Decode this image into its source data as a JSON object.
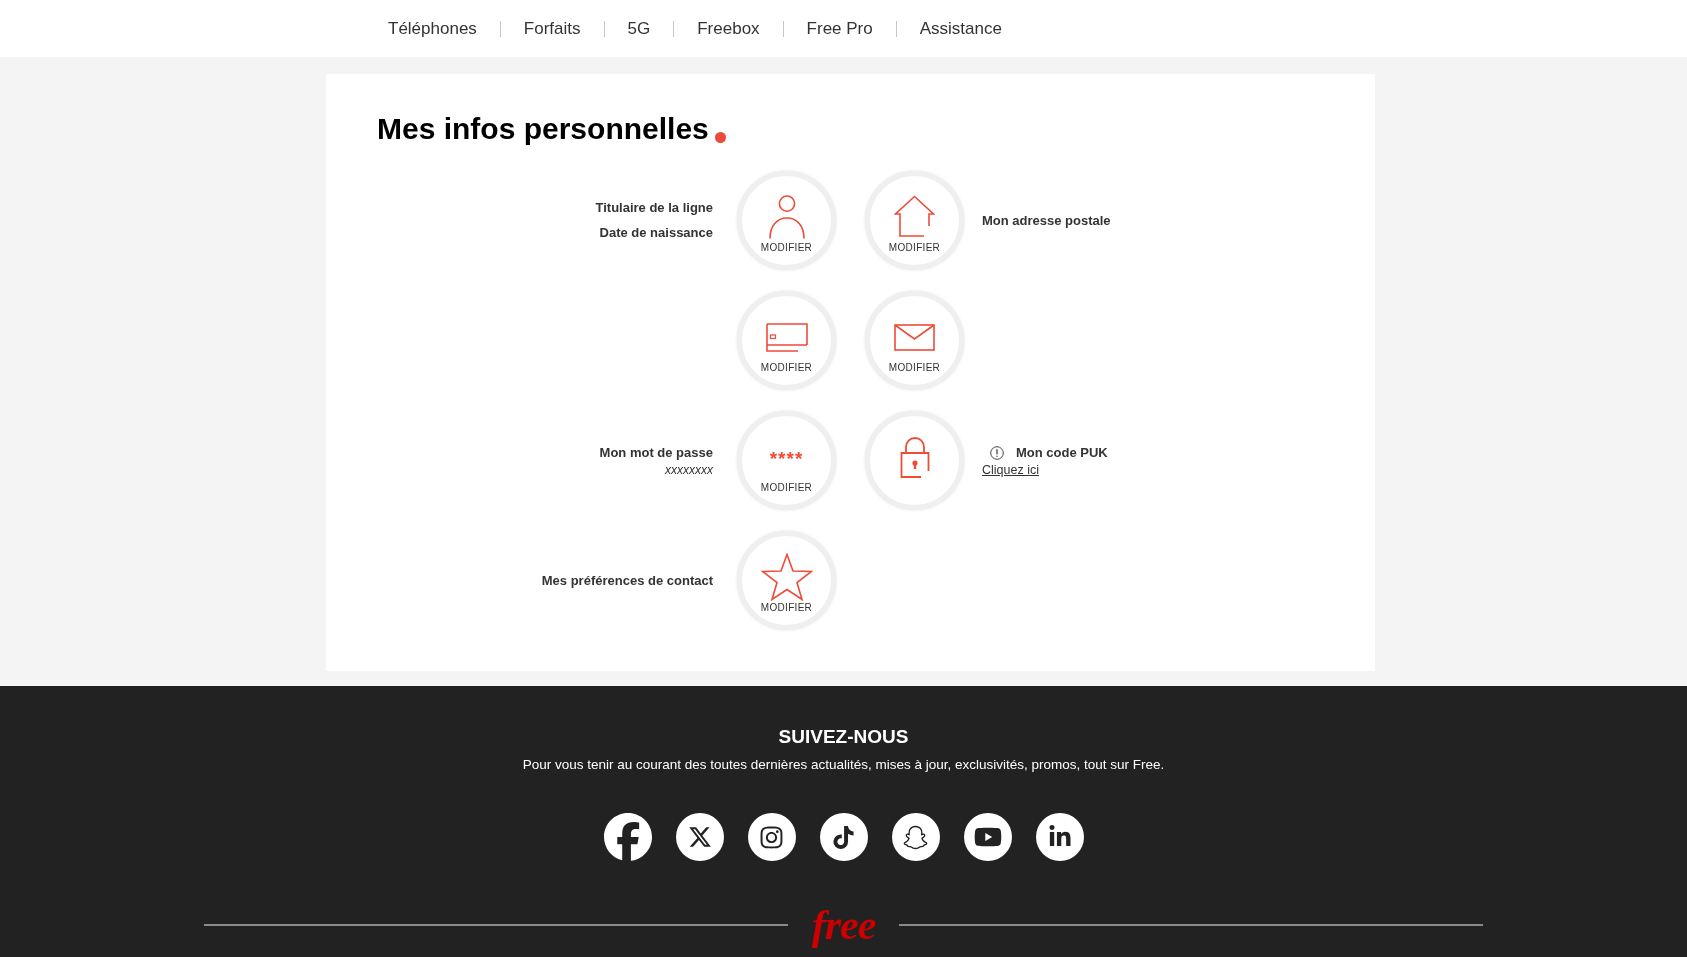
{
  "nav": [
    {
      "label": "Téléphones"
    },
    {
      "label": "Forfaits"
    },
    {
      "label": "5G"
    },
    {
      "label": "Freebox"
    },
    {
      "label": "Free Pro"
    },
    {
      "label": "Assistance"
    }
  ],
  "page": {
    "title": "Mes infos personnelles",
    "rows": [
      {
        "labels": [
          "Titulaire de la ligne",
          "Date de naissance"
        ],
        "tiles": [
          {
            "kind": "holder",
            "action": "MODIFIER"
          },
          {
            "kind": "address",
            "action": "MODIFIER"
          }
        ],
        "aside": {
          "kind": "plain",
          "title": "Mon adresse postale"
        }
      },
      {
        "tiles": [
          {
            "kind": "payment",
            "action": "MODIFIER"
          },
          {
            "kind": "email",
            "action": "MODIFIER"
          }
        ]
      },
      {
        "labels": [
          "Mon mot de passe"
        ],
        "value": "xxxxxxxx",
        "tiles": [
          {
            "kind": "password",
            "mask": "****",
            "action": "MODIFIER"
          },
          {
            "kind": "puk"
          }
        ],
        "aside": {
          "kind": "warning",
          "title": "Mon code PUK",
          "link": "Cliquez ici"
        }
      },
      {
        "labels": [
          "Mes préférences de contact"
        ],
        "tiles": [
          {
            "kind": "preferences",
            "action": "MODIFIER"
          }
        ]
      }
    ]
  },
  "footer": {
    "heading": "SUIVEZ-NOUS",
    "text": "Pour vous tenir au courant des toutes dernières actualités, mises à jour, exclusivités, promos, tout sur Free.",
    "logo": "free"
  }
}
